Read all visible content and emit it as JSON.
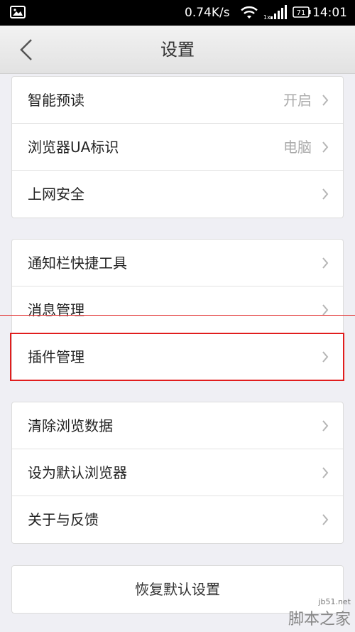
{
  "statusbar": {
    "speed": "0.74K/s",
    "battery": "71",
    "signal_label": "1x",
    "time": "14:01"
  },
  "header": {
    "title": "设置"
  },
  "groups": [
    {
      "items": [
        {
          "label": "智能预读",
          "value": "开启"
        },
        {
          "label": "浏览器UA标识",
          "value": "电脑"
        },
        {
          "label": "上网安全",
          "value": ""
        }
      ]
    },
    {
      "items": [
        {
          "label": "通知栏快捷工具",
          "value": ""
        },
        {
          "label": "消息管理",
          "value": ""
        },
        {
          "label": "插件管理",
          "value": ""
        }
      ]
    },
    {
      "items": [
        {
          "label": "清除浏览数据",
          "value": ""
        },
        {
          "label": "设为默认浏览器",
          "value": ""
        },
        {
          "label": "关于与反馈",
          "value": ""
        }
      ]
    }
  ],
  "reset": {
    "label": "恢复默认设置"
  },
  "watermark": {
    "site": "jb51.net",
    "name": "脚本之家"
  },
  "colors": {
    "highlight": "#e11d1d",
    "background": "#efeff4"
  }
}
